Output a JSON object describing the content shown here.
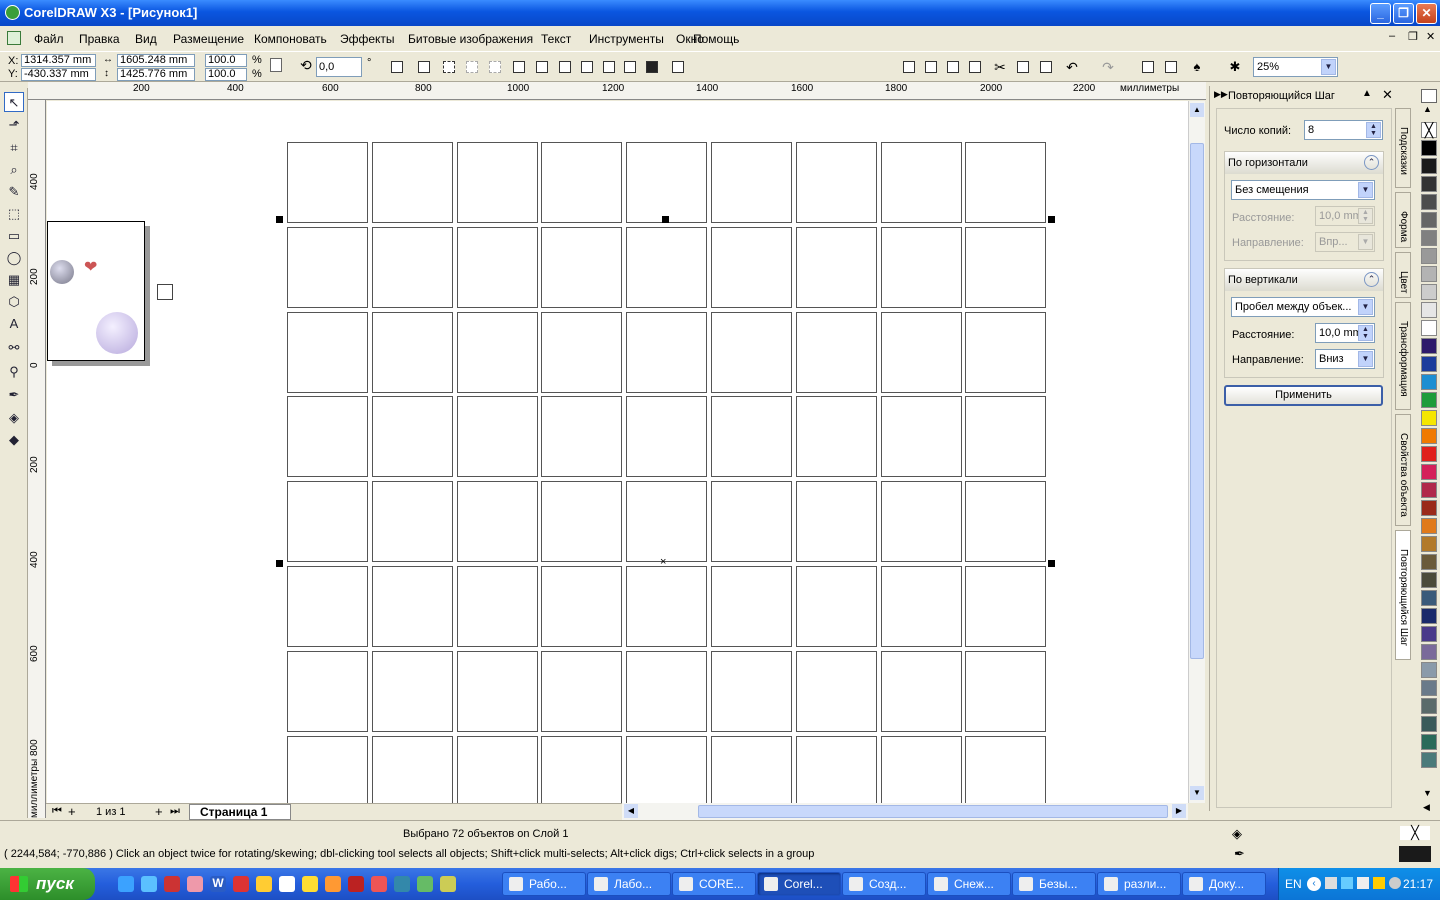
{
  "window": {
    "title": "CorelDRAW X3 - [Рисунок1]",
    "minimize": "_",
    "maximize": "❐",
    "close": "✕"
  },
  "menu": {
    "items": [
      "Файл",
      "Правка",
      "Вид",
      "Размещение",
      "Компоновать",
      "Эффекты",
      "Битовые изображения",
      "Текст",
      "Инструменты",
      "Окно",
      "Помощь"
    ]
  },
  "property_bar": {
    "x_label": "X:",
    "x_value": "1314.357 mm",
    "y_label": "Y:",
    "y_value": "-430.337 mm",
    "width_value": "1605.248 mm",
    "height_value": "1425.776 mm",
    "scale_x": "100.0",
    "scale_y": "100.0",
    "percent": "%",
    "angle": "0,0",
    "degree": "°",
    "zoom": "25%"
  },
  "ruler": {
    "top_ticks": [
      "200",
      "400",
      "600",
      "800",
      "1000",
      "1200",
      "1400",
      "1600",
      "1800",
      "2000",
      "2200"
    ],
    "unit": "миллиметры",
    "left_ticks": [
      "400",
      "200",
      "0",
      "200",
      "400",
      "600",
      "800"
    ],
    "left_unit": "миллиметры"
  },
  "grid": {
    "columns": 9,
    "rows": 8
  },
  "page_bar": {
    "page_count": "1 из 1",
    "page_tab": "Страница 1"
  },
  "docker": {
    "title": "Повторяющийся Шаг",
    "copies_label": "Число копий:",
    "copies_value": "8",
    "horizontal": {
      "title": "По горизонтали",
      "mode": "Без смещения",
      "distance_label": "Расстояние:",
      "distance_value": "10,0 mm",
      "direction_label": "Направление:",
      "direction_value": "Впр..."
    },
    "vertical": {
      "title": "По вертикали",
      "mode": "Пробел между объек...",
      "distance_label": "Расстояние:",
      "distance_value": "10,0 mm",
      "direction_label": "Направление:",
      "direction_value": "Вниз"
    },
    "apply": "Применить"
  },
  "side_tabs": [
    "Подсказки",
    "Форма",
    "Цвет",
    "Трансформация",
    "Свойства объекта",
    "Повторяющийся Шаг"
  ],
  "palette": {
    "colors": [
      "#000000",
      "#1a1a1a",
      "#333333",
      "#4d4d4d",
      "#666666",
      "#808080",
      "#999999",
      "#b3b3b3",
      "#cccccc",
      "#e6e6e6",
      "#ffffff",
      "#2e1a6b",
      "#1c3c9c",
      "#1d8ed2",
      "#1d9c3a",
      "#f5e600",
      "#f07a00",
      "#e0201c",
      "#d4205a",
      "#b0284a",
      "#9a2a1a",
      "#e07a1a",
      "#b27a2a",
      "#6a5a3a",
      "#4a4a3a",
      "#3a5a7a",
      "#1a2a6a",
      "#4a3a8a",
      "#7a6a9a",
      "#8a9aaa",
      "#6a7a8a",
      "#5a6a6a",
      "#3a5a5a",
      "#2a6a5a",
      "#4a7a7a"
    ]
  },
  "status": {
    "selection": "Выбрано 72 объектов on Слой 1",
    "hint": "( 2244,584; -770,886 ) Click an object twice for rotating/skewing; dbl-clicking tool selects all objects; Shift+click multi-selects; Alt+click digs; Ctrl+click selects in a group"
  },
  "taskbar": {
    "start": "пуск",
    "tasks": [
      "Рабо...",
      "Лабо...",
      "CORE...",
      "Corel...",
      "Созд...",
      "Снеж...",
      "Безы...",
      "разли...",
      "Доку..."
    ],
    "active_index": 3,
    "lang": "EN",
    "clock": "21:17"
  }
}
